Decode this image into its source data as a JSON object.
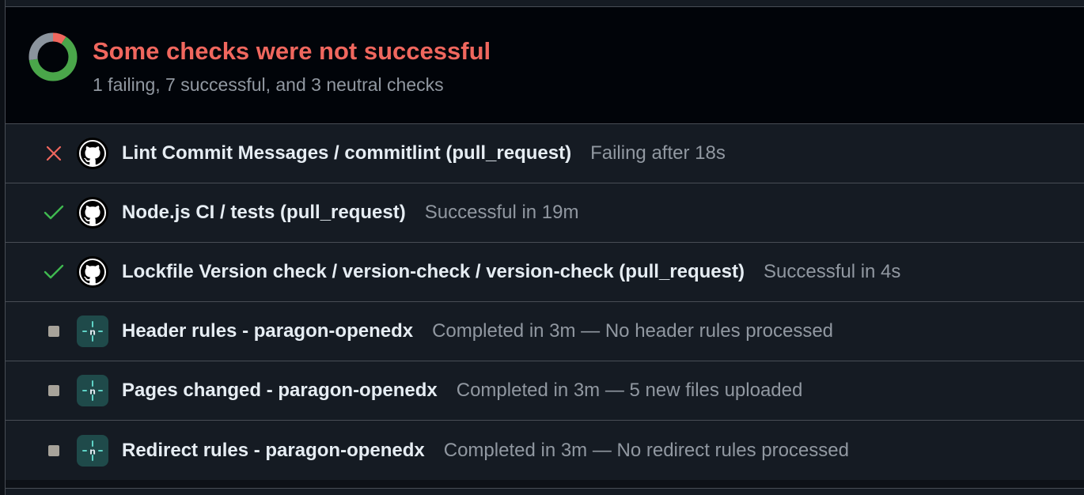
{
  "summary": {
    "title": "Some checks were not successful",
    "subtitle": "1 failing, 7 successful, and 3 neutral checks",
    "failing": 1,
    "successful": 7,
    "neutral": 3
  },
  "colors": {
    "failing": "#f0675e",
    "success": "#3fb950",
    "neutral": "#a7a39a",
    "donut_success": "#4aa64a",
    "donut_neutral": "#8b949e"
  },
  "checks": [
    {
      "status": "failing",
      "status_icon": "x-icon",
      "app_icon": "github-icon",
      "name": "Lint Commit Messages / commitlint (pull_request)",
      "detail": "Failing after 18s"
    },
    {
      "status": "success",
      "status_icon": "check-icon",
      "app_icon": "github-icon",
      "name": "Node.js CI / tests (pull_request)",
      "detail": "Successful in 19m"
    },
    {
      "status": "success",
      "status_icon": "check-icon",
      "app_icon": "github-icon",
      "name": "Lockfile Version check / version-check / version-check (pull_request)",
      "detail": "Successful in 4s"
    },
    {
      "status": "neutral",
      "status_icon": "square-icon",
      "app_icon": "netlify-icon",
      "name": "Header rules - paragon-openedx",
      "detail": "Completed in 3m — No header rules processed"
    },
    {
      "status": "neutral",
      "status_icon": "square-icon",
      "app_icon": "netlify-icon",
      "name": "Pages changed - paragon-openedx",
      "detail": "Completed in 3m — 5 new files uploaded"
    },
    {
      "status": "neutral",
      "status_icon": "square-icon",
      "app_icon": "netlify-icon",
      "name": "Redirect rules - paragon-openedx",
      "detail": "Completed in 3m — No redirect rules processed"
    }
  ]
}
